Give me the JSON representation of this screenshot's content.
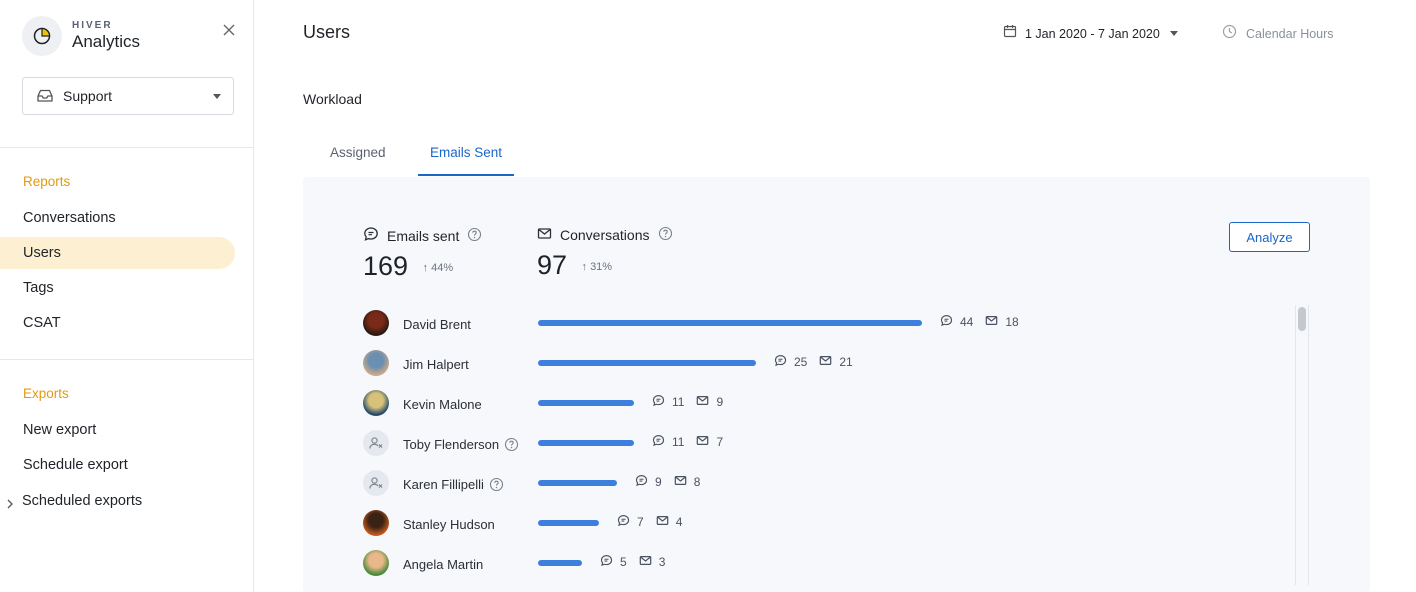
{
  "brand": {
    "small": "HIVER",
    "big": "Analytics"
  },
  "inbox": {
    "selected": "Support"
  },
  "sidebar": {
    "reports_title": "Reports",
    "reports": [
      "Conversations",
      "Users",
      "Tags",
      "CSAT"
    ],
    "active": "Users",
    "exports_title": "Exports",
    "exports": [
      "New export",
      "Schedule export",
      "Scheduled exports"
    ]
  },
  "header": {
    "title": "Users",
    "date_range": "1 Jan 2020 - 7 Jan 2020",
    "hours": "Calendar Hours"
  },
  "section": {
    "title": "Workload"
  },
  "tabs": [
    {
      "label": "Assigned",
      "active": false
    },
    {
      "label": "Emails Sent",
      "active": true
    }
  ],
  "metrics": {
    "emails_sent": {
      "label": "Emails sent",
      "value": "169",
      "change": "44%"
    },
    "conversations": {
      "label": "Conversations",
      "value": "97",
      "change": "31%"
    }
  },
  "analyze_label": "Analyze",
  "colors": {
    "accent": "#1a66c9",
    "bar": "#3d7fdd",
    "active_nav": "#fdefd2",
    "section_title": "#e09a16"
  },
  "users": [
    {
      "name": "David Brent",
      "emails": 44,
      "conversations": 18,
      "avatar": "photo",
      "help": false
    },
    {
      "name": "Jim Halpert",
      "emails": 25,
      "conversations": 21,
      "avatar": "photo",
      "help": false
    },
    {
      "name": "Kevin Malone",
      "emails": 11,
      "conversations": 9,
      "avatar": "photo",
      "help": false
    },
    {
      "name": "Toby Flenderson",
      "emails": 11,
      "conversations": 7,
      "avatar": "placeholder",
      "help": true
    },
    {
      "name": "Karen Fillipelli",
      "emails": 9,
      "conversations": 8,
      "avatar": "placeholder",
      "help": true
    },
    {
      "name": "Stanley Hudson",
      "emails": 7,
      "conversations": 4,
      "avatar": "photo",
      "help": false
    },
    {
      "name": "Angela Martin",
      "emails": 5,
      "conversations": 3,
      "avatar": "photo",
      "help": false
    }
  ]
}
